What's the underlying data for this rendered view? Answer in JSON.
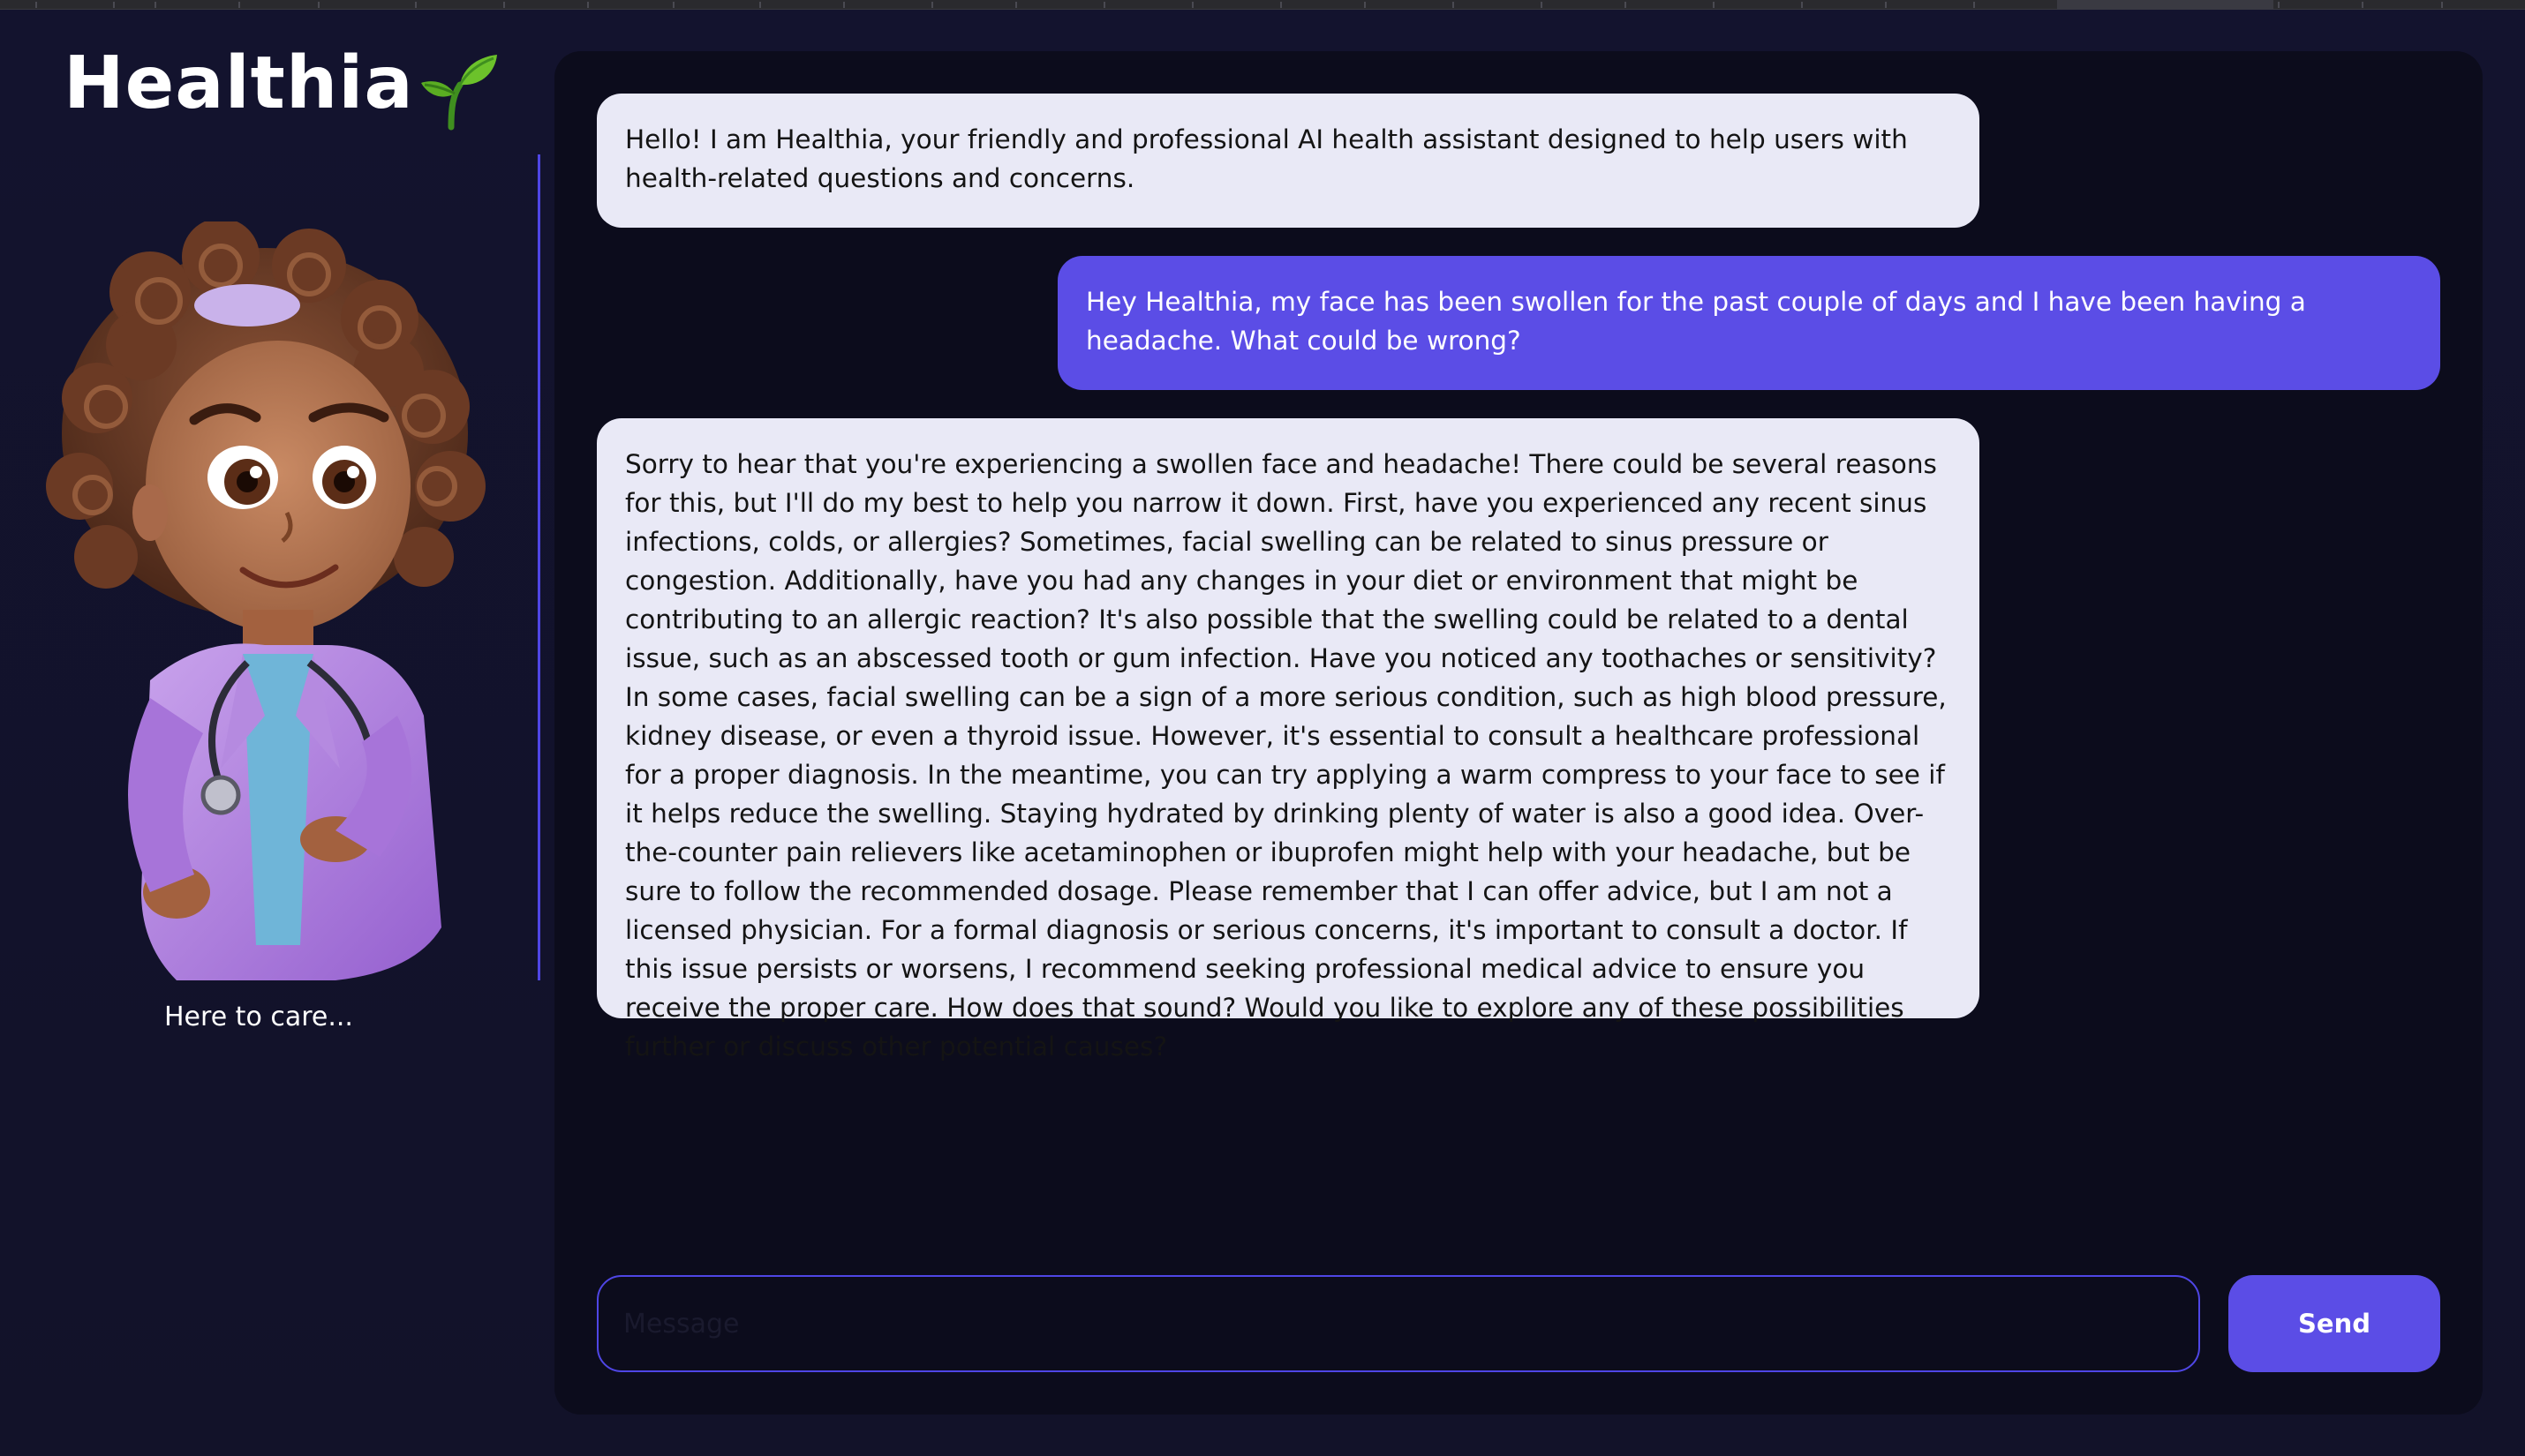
{
  "app": {
    "brand": "Healthia",
    "caption": "Here to care..."
  },
  "icons": {
    "logo_icon": "sprout-icon",
    "avatar": "doctor-avatar-illustration"
  },
  "colors": {
    "background": "#13132e",
    "chat_panel": "#0c0c1c",
    "accent": "#5b4de6",
    "bot_bubble": "#e9e9f6",
    "user_bubble": "#5b4de6"
  },
  "chat": {
    "messages": [
      {
        "role": "assistant",
        "text": "Hello! I am Healthia, your friendly and professional AI health assistant designed to help users with health-related questions and concerns."
      },
      {
        "role": "user",
        "text": "Hey Healthia, my face has been swollen for the past couple of days and I have been having a headache. What could be wrong?"
      },
      {
        "role": "assistant",
        "text": "Sorry to hear that you're experiencing a swollen face and headache! There could be several reasons for this, but I'll do my best to help you narrow it down. First, have you experienced any recent sinus infections, colds, or allergies? Sometimes, facial swelling can be related to sinus pressure or congestion. Additionally, have you had any changes in your diet or environment that might be contributing to an allergic reaction? It's also possible that the swelling could be related to a dental issue, such as an abscessed tooth or gum infection. Have you noticed any toothaches or sensitivity? In some cases, facial swelling can be a sign of a more serious condition, such as high blood pressure, kidney disease, or even a thyroid issue. However, it's essential to consult a healthcare professional for a proper diagnosis. In the meantime, you can try applying a warm compress to your face to see if it helps reduce the swelling. Staying hydrated by drinking plenty of water is also a good idea. Over-the-counter pain relievers like acetaminophen or ibuprofen might help with your headache, but be sure to follow the recommended dosage. Please remember that I can offer advice, but I am not a licensed physician. For a formal diagnosis or serious concerns, it's important to consult a doctor. If this issue persists or worsens, I recommend seeking professional medical advice to ensure you receive the proper care. How does that sound? Would you like to explore any of these possibilities further or discuss other potential causes?"
      }
    ]
  },
  "composer": {
    "placeholder": "Message",
    "value": "",
    "send_label": "Send"
  }
}
